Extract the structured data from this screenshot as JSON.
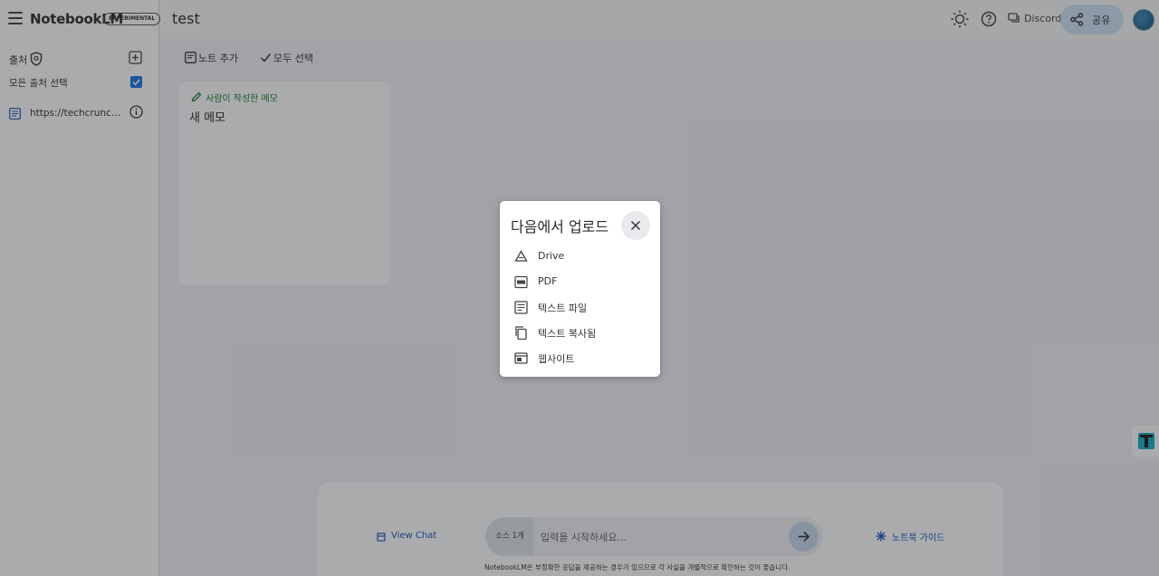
{
  "header": {
    "brand": "NotebookLM",
    "badge": "EXPERIMENTAL",
    "notebook_title": "test",
    "discord_label": "Discord",
    "share_label": "공유",
    "icons": [
      "menu-icon",
      "theme-icon",
      "help-icon",
      "discord-icon",
      "share-icon",
      "avatar"
    ]
  },
  "sidebar": {
    "heading": "출처",
    "select_all": "모든 출처 선택",
    "select_all_checked": true,
    "sources": [
      {
        "label": "https://techcrunch.co...",
        "icon": "document-icon"
      }
    ]
  },
  "toolbar": {
    "add_note": "노트 추가",
    "select_all": "모두 선택"
  },
  "notes": [
    {
      "type_label": "사람이 작성한 메모",
      "title": "새 메모"
    }
  ],
  "chat": {
    "view_chat": "View Chat",
    "source_count": "소스 1개",
    "placeholder": "입력을 시작하세요...",
    "guide": "노트북 가이드",
    "disclaimer": "NotebookLM은 부정확한 응답을 제공하는 경우가 있으므로 각 사실을 개별적으로 확인하는 것이 좋습니다."
  },
  "upload_dialog": {
    "title": "다음에서 업로드",
    "options": [
      {
        "label": "Drive",
        "icon": "drive-icon"
      },
      {
        "label": "PDF",
        "icon": "pdf-icon"
      },
      {
        "label": "텍스트 파일",
        "icon": "text-file-icon"
      },
      {
        "label": "텍스트 복사됨",
        "icon": "copy-icon"
      },
      {
        "label": "웹사이트",
        "icon": "website-icon"
      }
    ]
  },
  "colors": {
    "accent": "#1a73e8",
    "note_type": "#188038",
    "share_bg": "#cfe4f7",
    "scrim": "rgba(32,33,36,0.38)"
  }
}
